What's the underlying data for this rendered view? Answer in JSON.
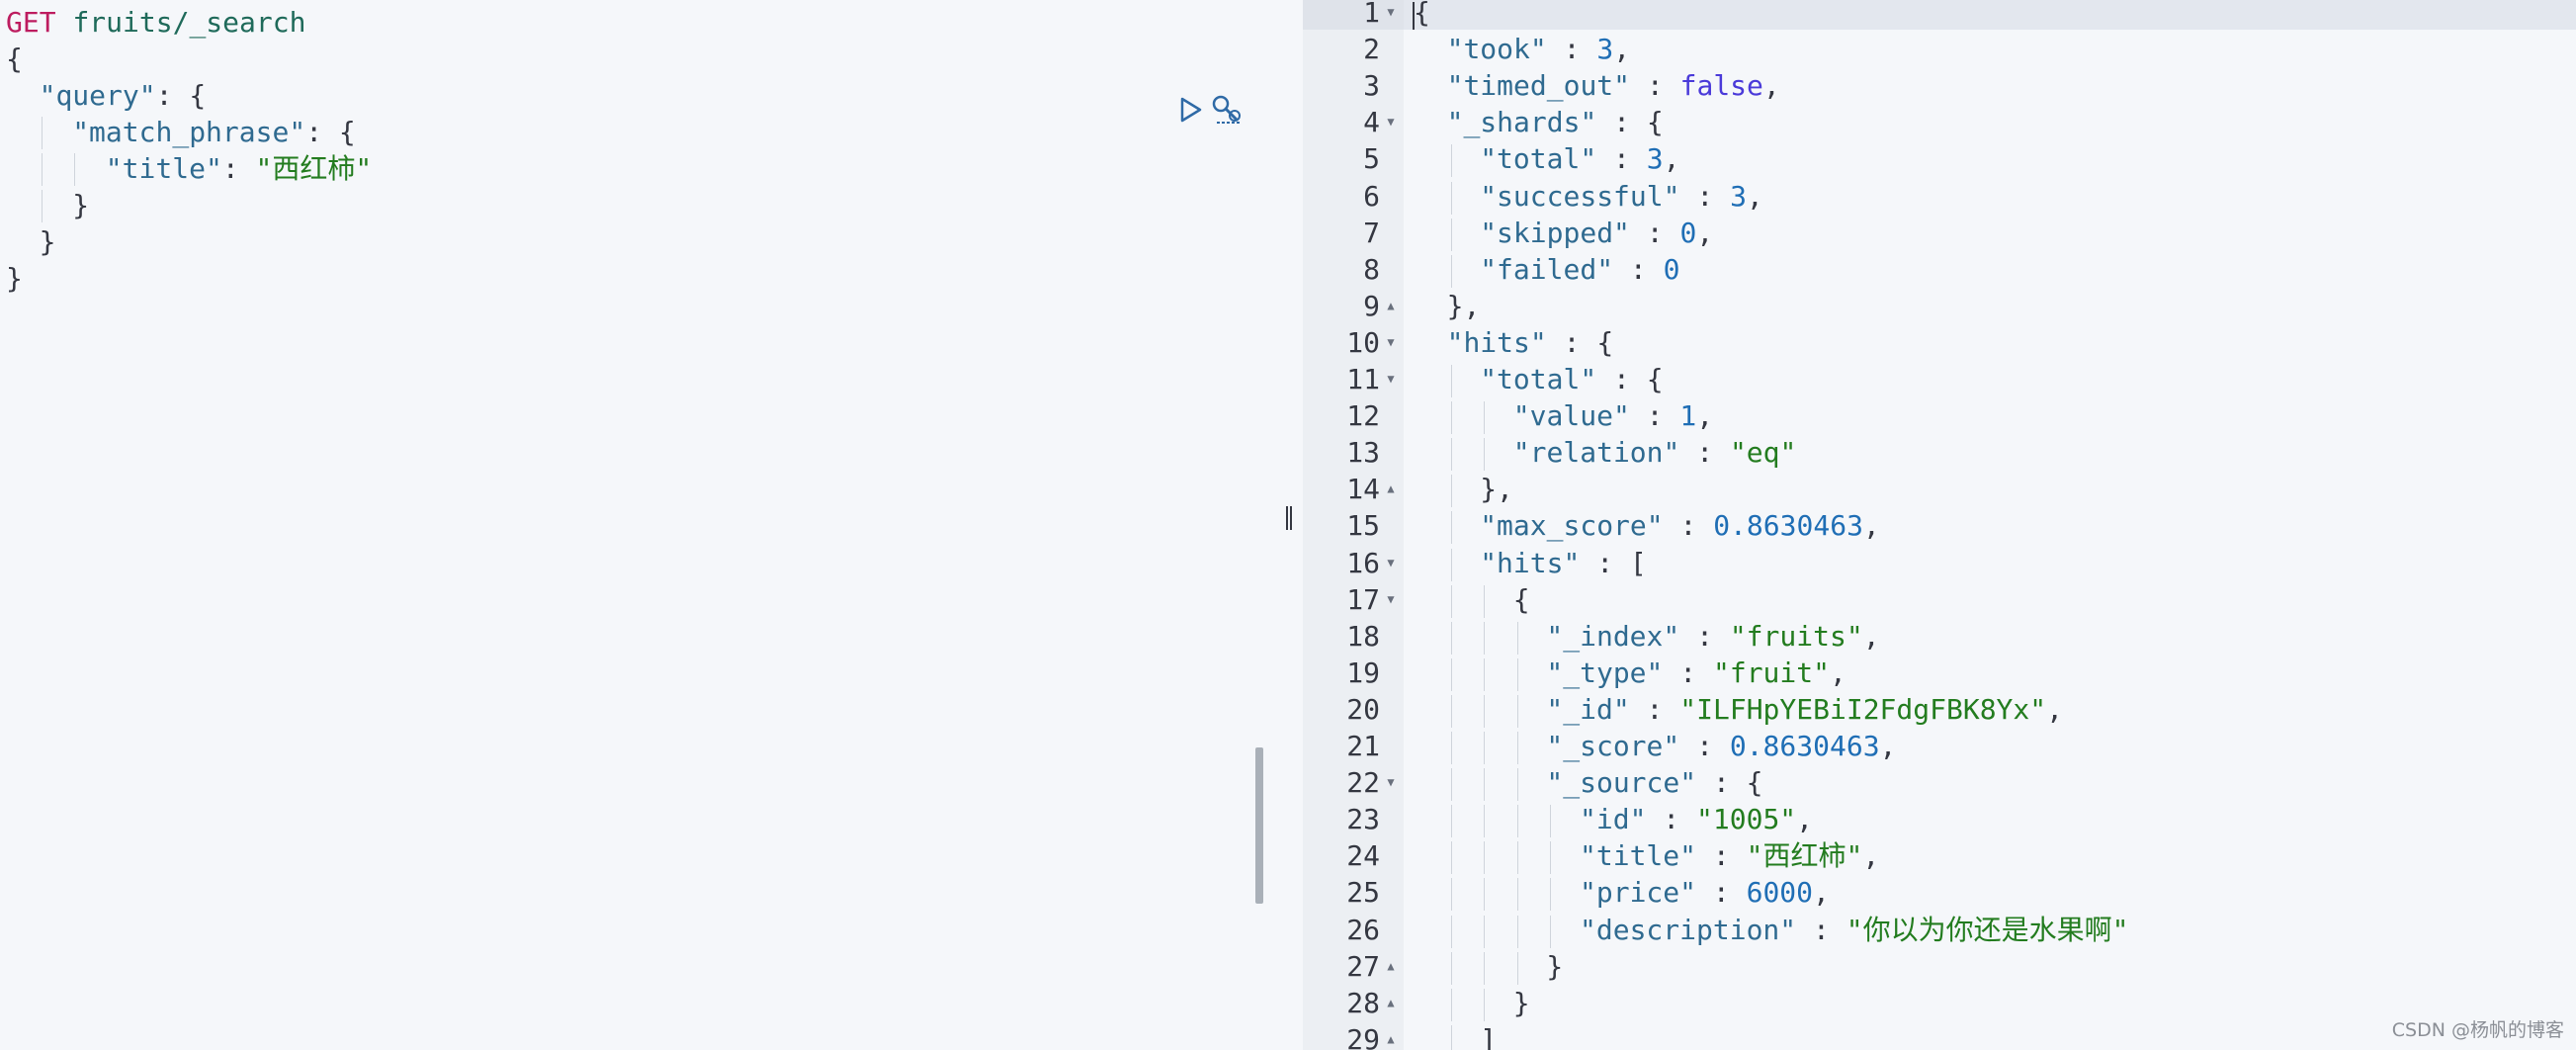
{
  "request": {
    "method": "GET",
    "path": "fruits/_search",
    "lines": [
      {
        "indent": 0,
        "parts": [
          {
            "t": "method",
            "v": "GET"
          },
          {
            "t": "punc",
            "v": " "
          },
          {
            "t": "path",
            "v": "fruits/_search"
          }
        ]
      },
      {
        "indent": 0,
        "parts": [
          {
            "t": "punc",
            "v": "{"
          }
        ]
      },
      {
        "indent": 1,
        "parts": [
          {
            "t": "key",
            "v": "\"query\""
          },
          {
            "t": "punc",
            "v": ": {"
          }
        ]
      },
      {
        "indent": 2,
        "parts": [
          {
            "t": "key",
            "v": "\"match_phrase\""
          },
          {
            "t": "punc",
            "v": ": {"
          }
        ]
      },
      {
        "indent": 3,
        "parts": [
          {
            "t": "key",
            "v": "\"title\""
          },
          {
            "t": "punc",
            "v": ": "
          },
          {
            "t": "str",
            "v": "\"西红柿\""
          }
        ]
      },
      {
        "indent": 2,
        "parts": [
          {
            "t": "punc",
            "v": "}"
          }
        ]
      },
      {
        "indent": 1,
        "parts": [
          {
            "t": "punc",
            "v": "}"
          }
        ]
      },
      {
        "indent": 0,
        "parts": [
          {
            "t": "punc",
            "v": "}"
          }
        ]
      }
    ]
  },
  "response": {
    "lines": [
      {
        "n": "1",
        "fold": "down",
        "indent": 0,
        "parts": [
          {
            "t": "punc",
            "v": "{"
          }
        ]
      },
      {
        "n": "2",
        "fold": "",
        "indent": 1,
        "parts": [
          {
            "t": "key",
            "v": "\"took\""
          },
          {
            "t": "punc",
            "v": " : "
          },
          {
            "t": "num",
            "v": "3"
          },
          {
            "t": "punc",
            "v": ","
          }
        ]
      },
      {
        "n": "3",
        "fold": "",
        "indent": 1,
        "parts": [
          {
            "t": "key",
            "v": "\"timed_out\""
          },
          {
            "t": "punc",
            "v": " : "
          },
          {
            "t": "bool",
            "v": "false"
          },
          {
            "t": "punc",
            "v": ","
          }
        ]
      },
      {
        "n": "4",
        "fold": "down",
        "indent": 1,
        "parts": [
          {
            "t": "key",
            "v": "\"_shards\""
          },
          {
            "t": "punc",
            "v": " : {"
          }
        ]
      },
      {
        "n": "5",
        "fold": "",
        "indent": 2,
        "parts": [
          {
            "t": "key",
            "v": "\"total\""
          },
          {
            "t": "punc",
            "v": " : "
          },
          {
            "t": "num",
            "v": "3"
          },
          {
            "t": "punc",
            "v": ","
          }
        ]
      },
      {
        "n": "6",
        "fold": "",
        "indent": 2,
        "parts": [
          {
            "t": "key",
            "v": "\"successful\""
          },
          {
            "t": "punc",
            "v": " : "
          },
          {
            "t": "num",
            "v": "3"
          },
          {
            "t": "punc",
            "v": ","
          }
        ]
      },
      {
        "n": "7",
        "fold": "",
        "indent": 2,
        "parts": [
          {
            "t": "key",
            "v": "\"skipped\""
          },
          {
            "t": "punc",
            "v": " : "
          },
          {
            "t": "num",
            "v": "0"
          },
          {
            "t": "punc",
            "v": ","
          }
        ]
      },
      {
        "n": "8",
        "fold": "",
        "indent": 2,
        "parts": [
          {
            "t": "key",
            "v": "\"failed\""
          },
          {
            "t": "punc",
            "v": " : "
          },
          {
            "t": "num",
            "v": "0"
          }
        ]
      },
      {
        "n": "9",
        "fold": "up",
        "indent": 1,
        "parts": [
          {
            "t": "punc",
            "v": "},"
          }
        ]
      },
      {
        "n": "10",
        "fold": "down",
        "indent": 1,
        "parts": [
          {
            "t": "key",
            "v": "\"hits\""
          },
          {
            "t": "punc",
            "v": " : {"
          }
        ]
      },
      {
        "n": "11",
        "fold": "down",
        "indent": 2,
        "parts": [
          {
            "t": "key",
            "v": "\"total\""
          },
          {
            "t": "punc",
            "v": " : {"
          }
        ]
      },
      {
        "n": "12",
        "fold": "",
        "indent": 3,
        "parts": [
          {
            "t": "key",
            "v": "\"value\""
          },
          {
            "t": "punc",
            "v": " : "
          },
          {
            "t": "num",
            "v": "1"
          },
          {
            "t": "punc",
            "v": ","
          }
        ]
      },
      {
        "n": "13",
        "fold": "",
        "indent": 3,
        "parts": [
          {
            "t": "key",
            "v": "\"relation\""
          },
          {
            "t": "punc",
            "v": " : "
          },
          {
            "t": "str",
            "v": "\"eq\""
          }
        ]
      },
      {
        "n": "14",
        "fold": "up",
        "indent": 2,
        "parts": [
          {
            "t": "punc",
            "v": "},"
          }
        ]
      },
      {
        "n": "15",
        "fold": "",
        "indent": 2,
        "parts": [
          {
            "t": "key",
            "v": "\"max_score\""
          },
          {
            "t": "punc",
            "v": " : "
          },
          {
            "t": "num",
            "v": "0.8630463"
          },
          {
            "t": "punc",
            "v": ","
          }
        ]
      },
      {
        "n": "16",
        "fold": "down",
        "indent": 2,
        "parts": [
          {
            "t": "key",
            "v": "\"hits\""
          },
          {
            "t": "punc",
            "v": " : ["
          }
        ]
      },
      {
        "n": "17",
        "fold": "down",
        "indent": 3,
        "parts": [
          {
            "t": "punc",
            "v": "{"
          }
        ]
      },
      {
        "n": "18",
        "fold": "",
        "indent": 4,
        "parts": [
          {
            "t": "key",
            "v": "\"_index\""
          },
          {
            "t": "punc",
            "v": " : "
          },
          {
            "t": "str",
            "v": "\"fruits\""
          },
          {
            "t": "punc",
            "v": ","
          }
        ]
      },
      {
        "n": "19",
        "fold": "",
        "indent": 4,
        "parts": [
          {
            "t": "key",
            "v": "\"_type\""
          },
          {
            "t": "punc",
            "v": " : "
          },
          {
            "t": "str",
            "v": "\"fruit\""
          },
          {
            "t": "punc",
            "v": ","
          }
        ]
      },
      {
        "n": "20",
        "fold": "",
        "indent": 4,
        "parts": [
          {
            "t": "key",
            "v": "\"_id\""
          },
          {
            "t": "punc",
            "v": " : "
          },
          {
            "t": "str",
            "v": "\"ILFHpYEBiI2FdgFBK8Yx\""
          },
          {
            "t": "punc",
            "v": ","
          }
        ]
      },
      {
        "n": "21",
        "fold": "",
        "indent": 4,
        "parts": [
          {
            "t": "key",
            "v": "\"_score\""
          },
          {
            "t": "punc",
            "v": " : "
          },
          {
            "t": "num",
            "v": "0.8630463"
          },
          {
            "t": "punc",
            "v": ","
          }
        ]
      },
      {
        "n": "22",
        "fold": "down",
        "indent": 4,
        "parts": [
          {
            "t": "key",
            "v": "\"_source\""
          },
          {
            "t": "punc",
            "v": " : {"
          }
        ]
      },
      {
        "n": "23",
        "fold": "",
        "indent": 5,
        "parts": [
          {
            "t": "key",
            "v": "\"id\""
          },
          {
            "t": "punc",
            "v": " : "
          },
          {
            "t": "str",
            "v": "\"1005\""
          },
          {
            "t": "punc",
            "v": ","
          }
        ]
      },
      {
        "n": "24",
        "fold": "",
        "indent": 5,
        "parts": [
          {
            "t": "key",
            "v": "\"title\""
          },
          {
            "t": "punc",
            "v": " : "
          },
          {
            "t": "str",
            "v": "\"西红柿\""
          },
          {
            "t": "punc",
            "v": ","
          }
        ]
      },
      {
        "n": "25",
        "fold": "",
        "indent": 5,
        "parts": [
          {
            "t": "key",
            "v": "\"price\""
          },
          {
            "t": "punc",
            "v": " : "
          },
          {
            "t": "num",
            "v": "6000"
          },
          {
            "t": "punc",
            "v": ","
          }
        ]
      },
      {
        "n": "26",
        "fold": "",
        "indent": 5,
        "parts": [
          {
            "t": "key",
            "v": "\"description\""
          },
          {
            "t": "punc",
            "v": " : "
          },
          {
            "t": "str",
            "v": "\"你以为你还是水果啊\""
          }
        ]
      },
      {
        "n": "27",
        "fold": "up",
        "indent": 4,
        "parts": [
          {
            "t": "punc",
            "v": "}"
          }
        ]
      },
      {
        "n": "28",
        "fold": "up",
        "indent": 3,
        "parts": [
          {
            "t": "punc",
            "v": "}"
          }
        ]
      },
      {
        "n": "29",
        "fold": "up",
        "indent": 2,
        "parts": [
          {
            "t": "punc",
            "v": "]"
          }
        ]
      }
    ]
  },
  "icons": {
    "run": "play-icon",
    "settings": "wrench-icon"
  },
  "watermark": "CSDN @杨帆的博客",
  "colors": {
    "method": "#bd1c5f",
    "key": "#2f6a90",
    "string": "#237c1f",
    "number": "#1f6eb5",
    "boolean": "#4a3ad9"
  }
}
